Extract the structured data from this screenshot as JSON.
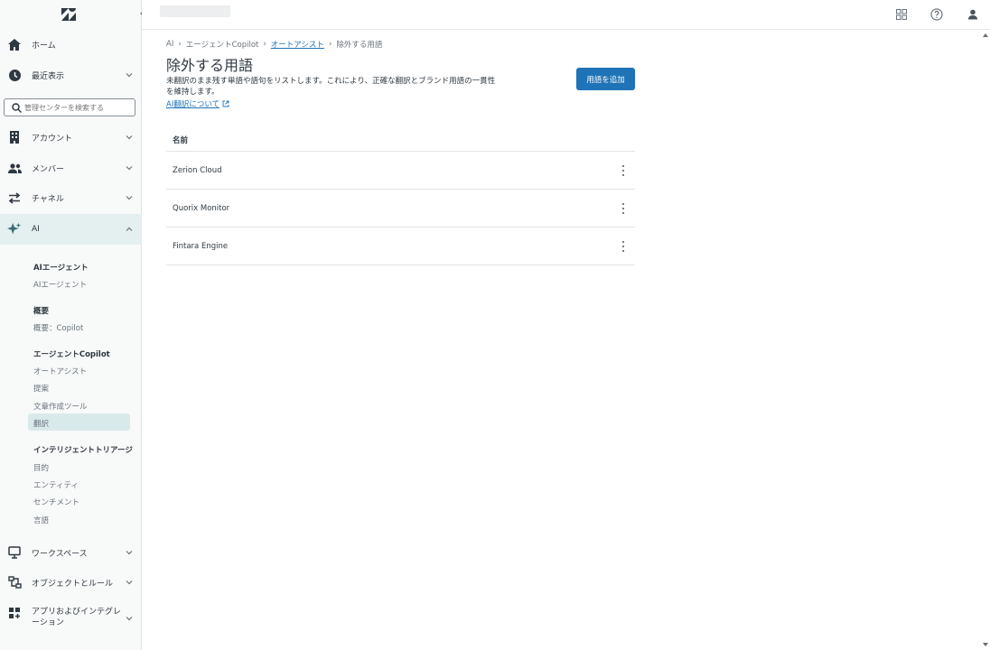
{
  "sidebar": {
    "search_placeholder": "管理センターを検索する",
    "nav": [
      {
        "label": "ホーム",
        "icon": "home-icon"
      },
      {
        "label": "最近表示",
        "icon": "clock-icon"
      },
      {
        "label": "アカウント",
        "icon": "building-icon"
      },
      {
        "label": "メンバー",
        "icon": "people-icon"
      },
      {
        "label": "チャネル",
        "icon": "arrows-icon"
      },
      {
        "label": "AI",
        "icon": "sparkle-icon"
      },
      {
        "label": "ワークスペース",
        "icon": "monitor-icon"
      },
      {
        "label": "オブジェクトとルール",
        "icon": "objects-rules-icon"
      },
      {
        "label": "アプリおよびインテグレーション",
        "icon": "apps-icon"
      }
    ],
    "ai_sections": [
      {
        "heading": "AIエージェント",
        "items": [
          "AIエージェント"
        ]
      },
      {
        "heading": "概要",
        "items": [
          "概要：Copilot"
        ]
      },
      {
        "heading": "エージェントCopilot",
        "items": [
          "オートアシスト",
          "提案",
          "文章作成ツール",
          "翻訳"
        ]
      },
      {
        "heading": "インテリジェントトリアージ",
        "items": [
          "目的",
          "エンティティ",
          "センチメント",
          "言語"
        ]
      }
    ]
  },
  "breadcrumb": {
    "items": [
      "AI",
      "エージェントCopilot",
      "オートアシスト",
      "除外する用語"
    ]
  },
  "page": {
    "title": "除外する用語",
    "description": "未翻訳のまま残す単語や語句をリストします。これにより、正確な翻訳とブランド用語の一貫性を維持します。",
    "learn_link": "AI翻訳について",
    "add_button": "用語を追加"
  },
  "table": {
    "header": "名前",
    "rows": [
      "Zerion Cloud",
      "Quorix Monitor",
      "Fintara Engine"
    ]
  },
  "colors": {
    "accent": "#1f73b7",
    "sidebar_bg": "#f8f9f9",
    "active_bg": "#e4eff0",
    "selected_sub_bg": "#d9eaea"
  }
}
